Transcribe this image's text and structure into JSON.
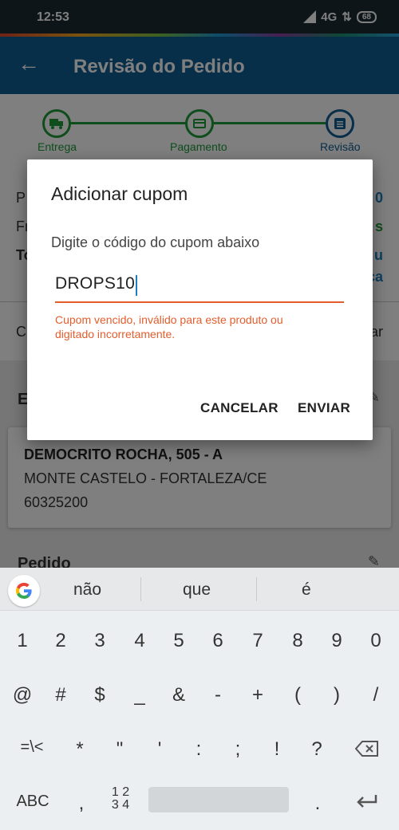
{
  "status_bar": {
    "time": "12:53",
    "network": "4G",
    "battery": "68"
  },
  "app_bar": {
    "back_icon": "arrow-back-icon",
    "title": "Revisão do Pedido"
  },
  "stepper": {
    "steps": [
      {
        "label": "Entrega",
        "icon": "truck-icon"
      },
      {
        "label": "Pagamento",
        "icon": "credit-card-icon"
      },
      {
        "label": "Revisão",
        "icon": "list-icon"
      }
    ],
    "colors": {
      "done": "#1e9b3a",
      "active": "#0f5e93"
    }
  },
  "background": {
    "summary_rows": [
      {
        "left": "P",
        "right": "0"
      },
      {
        "left": "Fr",
        "right": "s"
      },
      {
        "left": "To",
        "right": "u"
      },
      {
        "left": "",
        "right": "ca"
      }
    ],
    "coupon_row": {
      "left": "C",
      "right": "ar"
    },
    "delivery_section_initial": "E",
    "address": {
      "line1": "DEMOCRITO ROCHA, 505 - A",
      "line2": "MONTE CASTELO - FORTALEZA/CE",
      "line3": "60325200"
    },
    "order_section_title": "Pedido"
  },
  "dialog": {
    "title": "Adicionar cupom",
    "subtitle": "Digite o código do cupom abaixo",
    "input_value": "DROPS10",
    "error": "Cupom vencido, inválido para este produto ou digitado incorretamente.",
    "cancel_label": "CANCELAR",
    "submit_label": "ENVIAR",
    "error_color": "#e35d2c"
  },
  "keyboard": {
    "suggestions": [
      "não",
      "que",
      "é"
    ],
    "row_numbers": [
      "1",
      "2",
      "3",
      "4",
      "5",
      "6",
      "7",
      "8",
      "9",
      "0"
    ],
    "row_symbols1": [
      "@",
      "#",
      "$",
      "_",
      "&",
      "-",
      "+",
      "(",
      ")",
      "/"
    ],
    "row_symbols2": [
      "=\\<",
      "*",
      "\"",
      "'",
      ":",
      ";",
      "!",
      "?"
    ],
    "abc_label": "ABC",
    "comma": ",",
    "layout_top": "1 2",
    "layout_bottom": "3 4",
    "period": "."
  }
}
